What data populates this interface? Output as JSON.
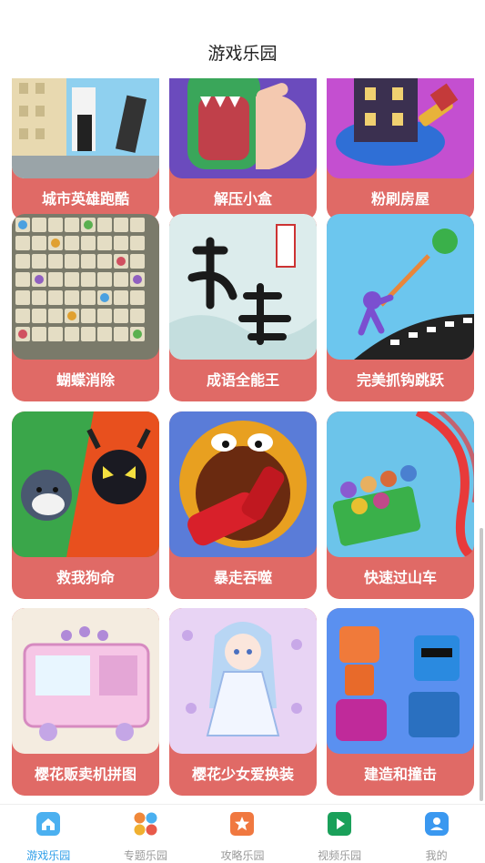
{
  "header": {
    "title": "游戏乐园"
  },
  "games": [
    {
      "name": "城市英雄跑酷",
      "icon": "city-hero-parkour-icon"
    },
    {
      "name": "解压小盒",
      "icon": "stress-relief-box-icon"
    },
    {
      "name": "粉刷房屋",
      "icon": "paint-house-icon"
    },
    {
      "name": "蝴蝶消除",
      "icon": "butterfly-match-icon"
    },
    {
      "name": "成语全能王",
      "icon": "idiom-master-icon"
    },
    {
      "name": "完美抓钩跳跃",
      "icon": "grapple-jump-icon"
    },
    {
      "name": "救我狗命",
      "icon": "save-dog-icon"
    },
    {
      "name": "暴走吞噬",
      "icon": "rampage-devour-icon"
    },
    {
      "name": "快速过山车",
      "icon": "roller-coaster-icon"
    },
    {
      "name": "樱花贩卖机拼图",
      "icon": "vending-puzzle-icon"
    },
    {
      "name": "樱花少女爱换装",
      "icon": "girl-dressup-icon"
    },
    {
      "name": "建造和撞击",
      "icon": "build-crash-icon"
    }
  ],
  "tabbar": {
    "items": [
      {
        "label": "游戏乐园",
        "icon": "home-icon",
        "active": true
      },
      {
        "label": "专题乐园",
        "icon": "grid-icon",
        "active": false
      },
      {
        "label": "攻略乐园",
        "icon": "star-icon",
        "active": false
      },
      {
        "label": "视频乐园",
        "icon": "play-icon",
        "active": false
      },
      {
        "label": "我的",
        "icon": "user-icon",
        "active": false
      }
    ]
  },
  "colors": {
    "card_bg": "#e06a66",
    "active_tab": "#2e9ee8",
    "inactive_tab": "#999999"
  }
}
